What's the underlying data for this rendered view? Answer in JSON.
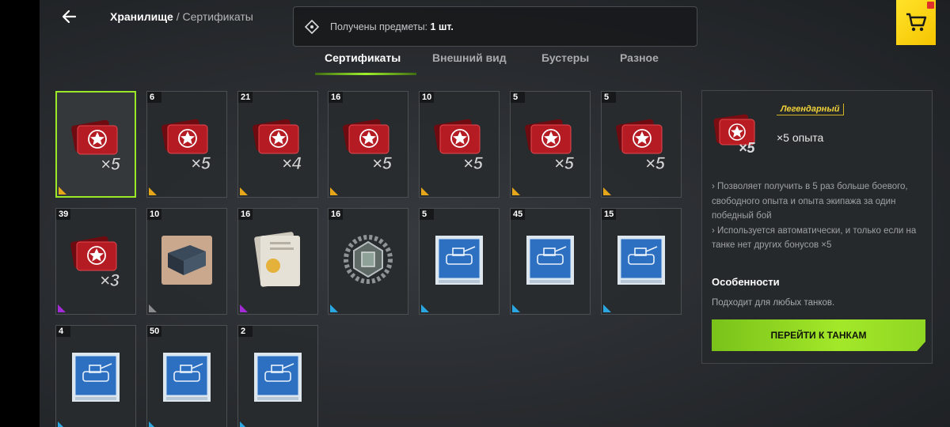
{
  "header": {
    "breadcrumb_main": "Хранилище",
    "breadcrumb_sep": " / ",
    "breadcrumb_sub": "Сертификаты"
  },
  "notice": {
    "label": "Получены предметы: ",
    "value": "1 шт."
  },
  "tabs": [
    {
      "label": "Сертификаты",
      "active": true
    },
    {
      "label": "Внешний вид",
      "active": false
    },
    {
      "label": "Бустеры",
      "active": false
    },
    {
      "label": "Разное",
      "active": false
    }
  ],
  "items": [
    {
      "count": "",
      "kind": "cert",
      "mult": "×5",
      "rarity": "legendary",
      "selected": true
    },
    {
      "count": "6",
      "kind": "cert",
      "mult": "×5",
      "rarity": "legendary"
    },
    {
      "count": "21",
      "kind": "cert",
      "mult": "×4",
      "rarity": "legendary"
    },
    {
      "count": "16",
      "kind": "cert",
      "mult": "×5",
      "rarity": "legendary"
    },
    {
      "count": "10",
      "kind": "cert",
      "mult": "×5",
      "rarity": "legendary"
    },
    {
      "count": "5",
      "kind": "cert",
      "mult": "×5",
      "rarity": "legendary"
    },
    {
      "count": "5",
      "kind": "cert",
      "mult": "×5",
      "rarity": "legendary"
    },
    {
      "count": "39",
      "kind": "cert",
      "mult": "×3",
      "rarity": "epic"
    },
    {
      "count": "10",
      "kind": "crate",
      "mult": "",
      "rarity": "common"
    },
    {
      "count": "16",
      "kind": "doc",
      "mult": "",
      "rarity": "epic"
    },
    {
      "count": "16",
      "kind": "medal",
      "mult": "",
      "rarity": "rare"
    },
    {
      "count": "5",
      "kind": "blueprint",
      "mult": "",
      "rarity": "rare"
    },
    {
      "count": "45",
      "kind": "blueprint",
      "mult": "",
      "rarity": "rare"
    },
    {
      "count": "15",
      "kind": "blueprint",
      "mult": "",
      "rarity": "rare"
    },
    {
      "count": "4",
      "kind": "blueprint",
      "mult": "",
      "rarity": "rare"
    },
    {
      "count": "50",
      "kind": "blueprint",
      "mult": "",
      "rarity": "rare"
    },
    {
      "count": "2",
      "kind": "blueprint",
      "mult": "",
      "rarity": "rare"
    }
  ],
  "detail": {
    "rarity_label": "Легендарный",
    "mult": "×5",
    "title": "×5 опыта",
    "desc_1": "› Позволяет получить в 5 раз больше боевого, свободного опыта и опыта экипажа за один победный бой",
    "desc_2": "› Используется автоматически, и только если на танке нет других бонусов ×5",
    "features_heading": "Особенности",
    "features_text": "Подходит для любых танков.",
    "button_label": "ПЕРЕЙТИ К ТАНКАМ"
  },
  "colors": {
    "accent": "#9be829",
    "legendary": "#e6a619",
    "epic": "#a22bd6",
    "rare": "#2aa6e0",
    "common": "#8a8c8e",
    "shop": "#ffd60a"
  }
}
